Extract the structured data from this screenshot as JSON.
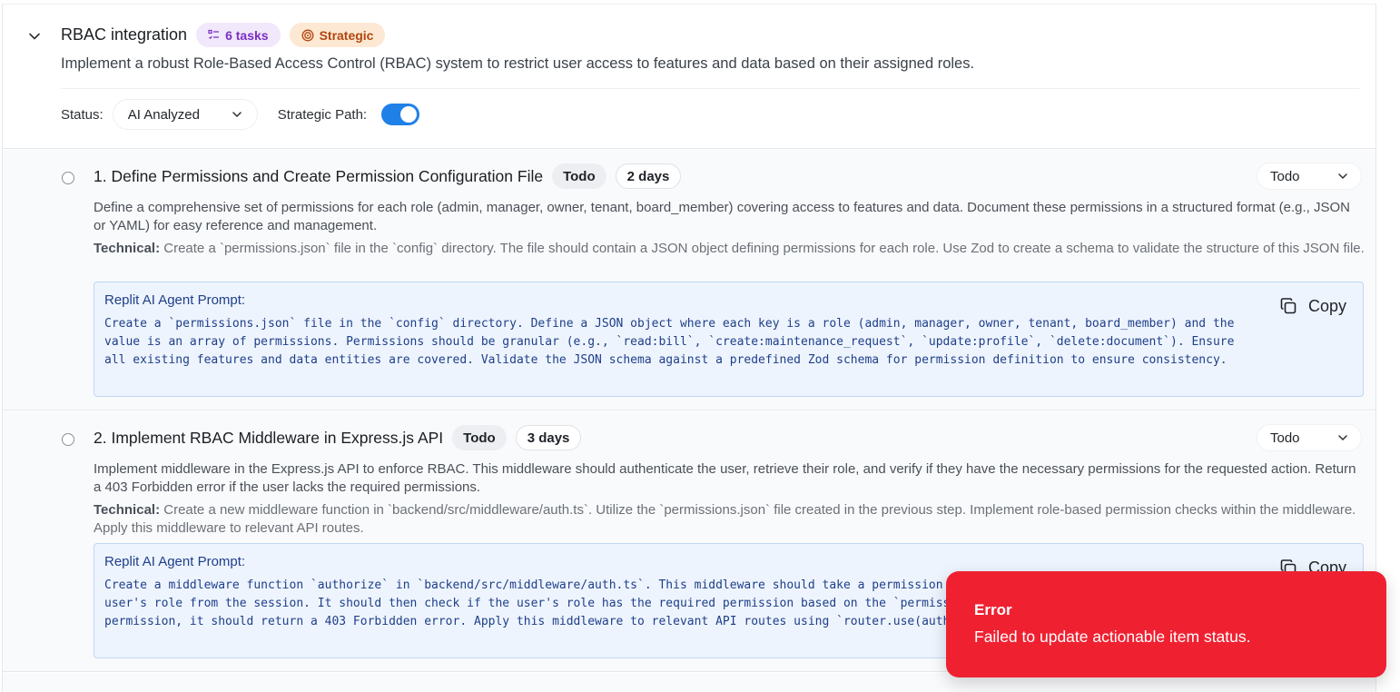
{
  "goal": {
    "title": "RBAC integration",
    "tasks_badge": "6 tasks",
    "strategic_badge": "Strategic",
    "description": "Implement a robust Role-Based Access Control (RBAC) system to restrict user access to features and data based on their assigned roles.",
    "status_label": "Status:",
    "status_value": "AI Analyzed",
    "strategic_path_label": "Strategic Path:",
    "strategic_path_on": true
  },
  "tasks": [
    {
      "title": "1. Define Permissions and Create Permission Configuration File",
      "status_chip": "Todo",
      "duration": "2 days",
      "status_select": "Todo",
      "description": "Define a comprehensive set of permissions for each role (admin, manager, owner, tenant, board_member) covering access to features and data. Document these permissions in a structured format (e.g., JSON or YAML) for easy reference and management.",
      "technical_label": "Technical:",
      "technical": "Create a `permissions.json` file in the `config` directory. The file should contain a JSON object defining permissions for each role. Use Zod to create a schema to validate the structure of this JSON file.",
      "prompt_title": "Replit AI Agent Prompt:",
      "prompt": "Create a `permissions.json` file in the `config` directory. Define a JSON object where each key is a role (admin, manager, owner, tenant, board_member) and the value is an array of permissions. Permissions should be granular (e.g., `read:bill`, `create:maintenance_request`, `update:profile`, `delete:document`). Ensure all existing features and data entities are covered. Validate the JSON schema against a predefined Zod schema for permission definition to ensure consistency.",
      "copy_label": "Copy"
    },
    {
      "title": "2. Implement RBAC Middleware in Express.js API",
      "status_chip": "Todo",
      "duration": "3 days",
      "status_select": "Todo",
      "description": "Implement middleware in the Express.js API to enforce RBAC. This middleware should authenticate the user, retrieve their role, and verify if they have the necessary permissions for the requested action. Return a 403 Forbidden error if the user lacks the required permissions.",
      "technical_label": "Technical:",
      "technical": "Create a new middleware function in `backend/src/middleware/auth.ts`. Utilize the `permissions.json` file created in the previous step. Implement role-based permission checks within the middleware. Apply this middleware to relevant API routes.",
      "prompt_title": "Replit AI Agent Prompt:",
      "prompt": "Create a middleware function `authorize` in `backend/src/middleware/auth.ts`. This middleware should take a permission string as an argument, retrieve the user's role from the session. It should then check if the user's role has the required permission based on the `permissions.json` file. If the user lacks the permission, it should return a 403 Forbidden error. Apply this middleware to relevant API routes using `router.use(authorize('permission_name'))` syntax.",
      "copy_label": "Copy"
    }
  ],
  "toast": {
    "title": "Error",
    "message": "Failed to update actionable item status."
  }
}
